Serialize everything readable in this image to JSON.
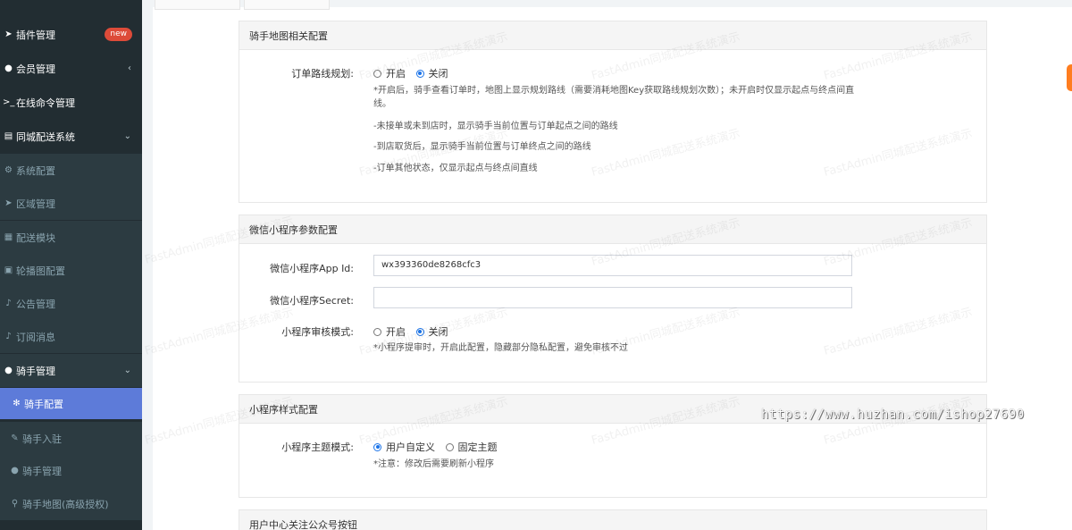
{
  "sidebar": {
    "items": [
      {
        "label": "插件管理",
        "icon": "rocket-icon",
        "badge": "new"
      },
      {
        "label": "会员管理",
        "icon": "user-circle-icon",
        "caret": "‹"
      },
      {
        "label": "在线命令管理",
        "icon": "terminal-icon"
      },
      {
        "label": "同城配送系统",
        "icon": "list-icon",
        "caret": "⌄"
      },
      {
        "label": "系统配置",
        "icon": "gears-icon"
      },
      {
        "label": "区域管理",
        "icon": "location-arrow-icon"
      },
      {
        "label": "配送模块",
        "icon": "grid-icon"
      },
      {
        "label": "轮播图配置",
        "icon": "image-icon"
      },
      {
        "label": "公告管理",
        "icon": "bell-icon"
      },
      {
        "label": "订阅消息",
        "icon": "bell-icon"
      },
      {
        "label": "骑手管理",
        "icon": "user-circle-icon",
        "caret": "⌄"
      },
      {
        "label": "骑手配置",
        "icon": "gear-icon"
      },
      {
        "label": "骑手入驻",
        "icon": "edit-icon"
      },
      {
        "label": "骑手管理",
        "icon": "user-circle-icon"
      },
      {
        "label": "骑手地图(高级授权)",
        "icon": "map-marker-icon"
      }
    ]
  },
  "panels": {
    "map": {
      "title": "骑手地图相关配置",
      "route_label": "订单路线规划:",
      "opt_on": "开启",
      "opt_off": "关闭",
      "help1": "*开启后，骑手查看订单时，地图上显示规划路线（需要消耗地图Key获取路线规划次数）；未开启时仅显示起点与终点间直线。",
      "help2": "-未接单或未到店时，显示骑手当前位置与订单起点之间的路线",
      "help3": "-到店取货后，显示骑手当前位置与订单终点之间的路线",
      "help4": "-订单其他状态，仅显示起点与终点间直线"
    },
    "wechat": {
      "title": "微信小程序参数配置",
      "appid_label": "微信小程序App Id:",
      "appid_value": "wx393360de8268cfc3",
      "secret_label": "微信小程序Secret:",
      "secret_value": "",
      "audit_label": "小程序审核模式:",
      "opt_on": "开启",
      "opt_off": "关闭",
      "audit_help": "*小程序提审时，开启此配置，隐藏部分隐私配置，避免审核不过"
    },
    "style": {
      "title": "小程序样式配置",
      "theme_label": "小程序主题模式:",
      "opt_custom": "用户自定义",
      "opt_fixed": "固定主题",
      "theme_help": "*注意：修改后需要刷新小程序"
    },
    "follow": {
      "title": "用户中心关注公众号按钮"
    }
  },
  "watermark": "FastAdmin同城配送系统演示",
  "url_overlay": "https://www.huzhan.com/ishop27690"
}
